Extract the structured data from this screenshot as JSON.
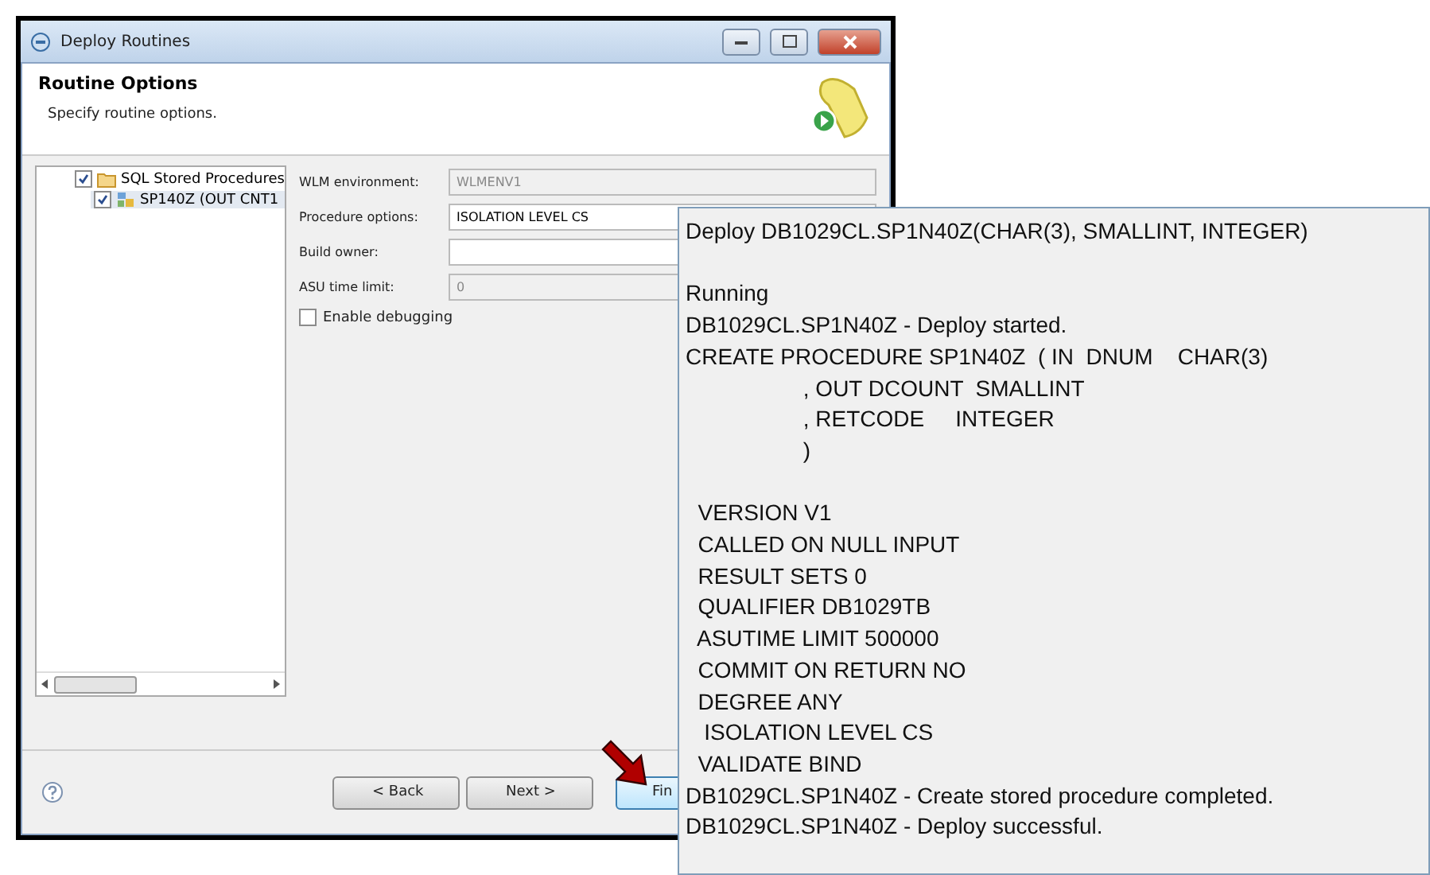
{
  "window": {
    "title": "Deploy Routines"
  },
  "header": {
    "title": "Routine Options",
    "subtitle": "Specify routine options."
  },
  "tree": [
    {
      "label": "SQL Stored Procedures",
      "checked": true,
      "kind": "folder",
      "children": [
        {
          "label": "SP140Z (OUT CNT1",
          "checked": true,
          "kind": "routine",
          "selected": true
        }
      ]
    }
  ],
  "form": {
    "fields": [
      {
        "label": "WLM environment:",
        "value": "WLMENV1",
        "disabled": true
      },
      {
        "label": "Procedure options:",
        "value": "ISOLATION LEVEL CS",
        "disabled": false
      },
      {
        "label": "Build owner:",
        "disabled": false
      },
      {
        "label": "ASU time limit:",
        "value": "0",
        "disabled": true
      }
    ],
    "checkbox": {
      "label": "Enable debugging",
      "checked": false
    }
  },
  "buttons": [
    {
      "label": "< Back",
      "default": false
    },
    {
      "label": "Next >",
      "default": false
    },
    {
      "label": "Fin",
      "default": true
    }
  ],
  "log": {
    "blocks": [
      [
        "Deploy DB1029CL.SP1N40Z(CHAR(3), SMALLINT, INTEGER)"
      ],
      [
        "Running",
        "DB1029CL.SP1N40Z - Deploy started.",
        "CREATE PROCEDURE SP1N40Z  ( IN  DNUM    CHAR(3)",
        "                   , OUT DCOUNT  SMALLINT",
        "                   , RETCODE     INTEGER",
        "                   )"
      ],
      [
        "  VERSION V1",
        "  CALLED ON NULL INPUT",
        "  RESULT SETS 0",
        "  QUALIFIER DB1029TB",
        "  ASUTIME LIMIT 500000",
        "  COMMIT ON RETURN NO",
        "  DEGREE ANY",
        "   ISOLATION LEVEL CS",
        "  VALIDATE BIND",
        "DB1029CL.SP1N40Z - Create stored procedure completed.",
        "DB1029CL.SP1N40Z - Deploy successful."
      ]
    ]
  }
}
